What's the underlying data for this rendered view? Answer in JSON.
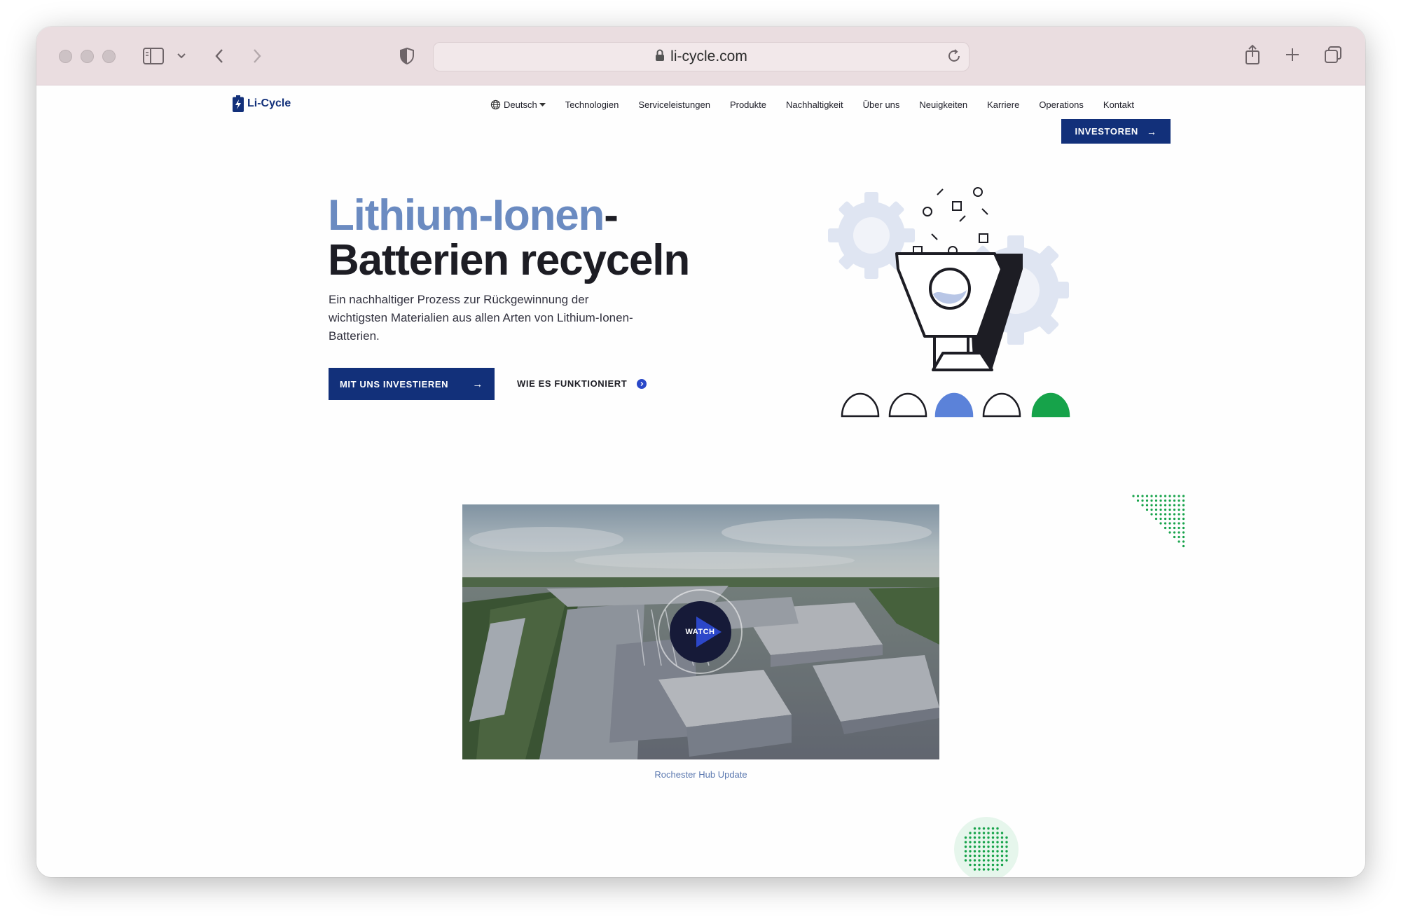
{
  "browser": {
    "url": "li-cycle.com",
    "icons": {
      "close": "traffic-light-close",
      "minimize": "traffic-light-minimize",
      "zoom": "traffic-light-zoom",
      "sidebar": "sidebar-icon",
      "chevron": "chevron-down-icon",
      "back": "back-arrow-icon",
      "forward": "forward-arrow-icon",
      "shield": "shield-icon",
      "lock": "lock-icon",
      "reload": "reload-icon",
      "share": "share-icon",
      "new_tab": "plus-icon",
      "tabs": "tabs-overview-icon"
    }
  },
  "header": {
    "logo_text": "Li-Cycle",
    "language": "Deutsch",
    "nav": [
      "Technologien",
      "Serviceleistungen",
      "Produkte",
      "Nachhaltigkeit",
      "Über uns",
      "Neuigkeiten",
      "Karriere",
      "Operations",
      "Kontakt"
    ],
    "investors_label": "INVESTOREN",
    "arrow_glyph": "→"
  },
  "hero": {
    "title_accent": "Lithium-Ionen",
    "title_dash": "-",
    "title_rest": "Batterien recyceln",
    "subtitle": "Ein nachhaltiger Prozess zur Rückgewinnung der wichtigsten Materialien aus allen Arten von Lithium-Ionen-Batterien.",
    "cta_primary": "MIT UNS INVESTIEREN",
    "cta_secondary": "WIE ES FUNKTIONIERT"
  },
  "video": {
    "watch_label": "WATCH",
    "caption": "Rochester Hub Update"
  },
  "colors": {
    "brand_navy": "#12307a",
    "accent_blue": "#6b8bc1",
    "illustration_blue": "#5b82d9",
    "green": "#16a34a",
    "gear_gray": "#dde3f0"
  }
}
